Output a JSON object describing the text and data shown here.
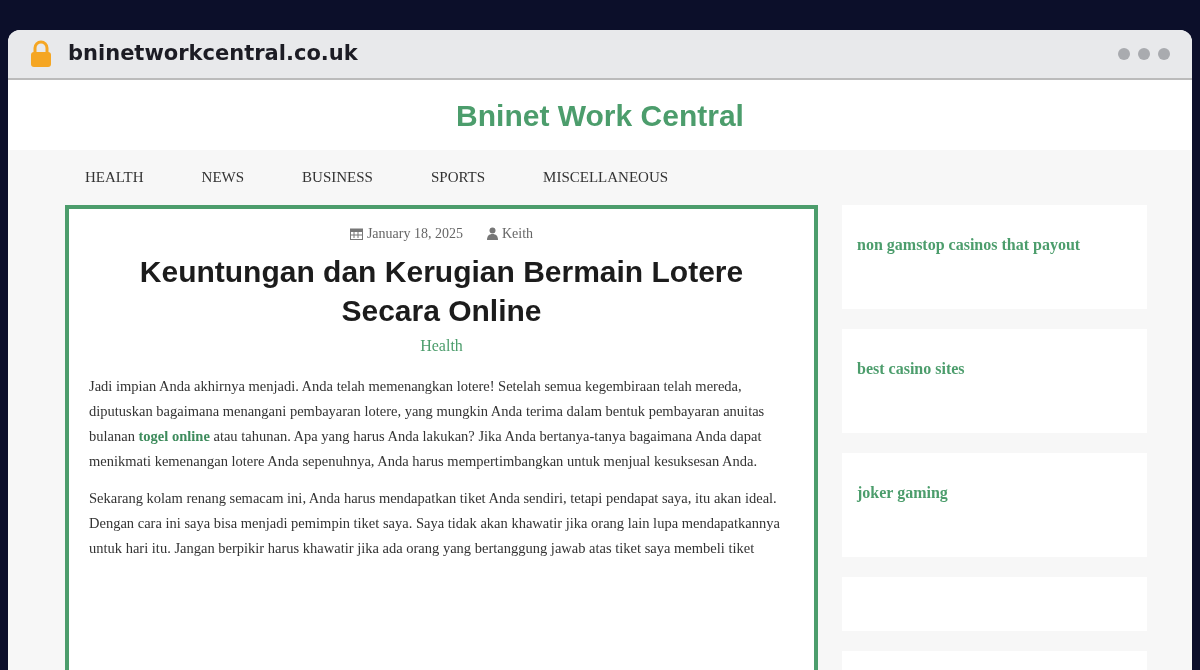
{
  "browser": {
    "address": "bninetworkcentral.co.uk"
  },
  "site": {
    "title": "Bninet Work Central"
  },
  "nav": [
    {
      "label": "HEALTH"
    },
    {
      "label": "NEWS"
    },
    {
      "label": "BUSINESS"
    },
    {
      "label": "SPORTS"
    },
    {
      "label": "MISCELLANEOUS"
    }
  ],
  "article": {
    "date": "January 18, 2025",
    "author": "Keith",
    "title": "Keuntungan dan Kerugian Bermain Lotere Secara Online",
    "category": "Health",
    "paragraphs": [
      {
        "before": "Jadi impian Anda akhirnya menjadi. Anda telah memenangkan lotere! Setelah semua kegembiraan telah mereda, diputuskan bagaimana menangani pembayaran lotere, yang mungkin Anda terima dalam bentuk pembayaran anuitas bulanan",
        "link": "togel online",
        "after": "atau tahunan. Apa yang harus Anda lakukan? Jika Anda bertanya-tanya bagaimana Anda dapat menikmati kemenangan lotere Anda sepenuhnya, Anda harus mempertimbangkan untuk menjual kesuksesan Anda."
      },
      {
        "before": "Sekarang kolam renang semacam ini, Anda harus mendapatkan tiket Anda sendiri, tetapi pendapat saya, itu akan ideal. Dengan cara ini saya bisa menjadi pemimpin tiket saya. Saya tidak akan khawatir jika orang lain lupa mendapatkannya untuk hari itu. Jangan berpikir harus khawatir jika ada orang yang bertanggung jawab atas tiket saya membeli tiket"
      }
    ]
  },
  "sidebar": [
    {
      "link": "non gamstop casinos that payout"
    },
    {
      "link": "best casino sites"
    },
    {
      "link": "joker gaming"
    }
  ]
}
